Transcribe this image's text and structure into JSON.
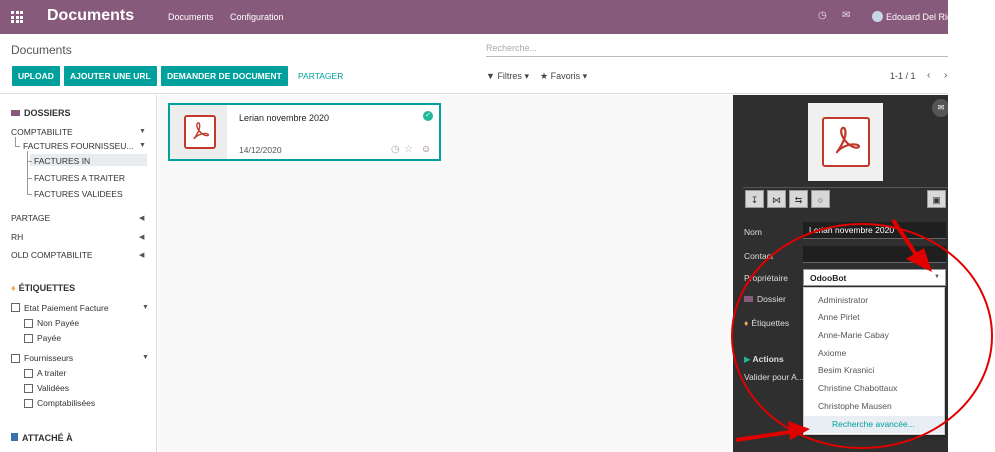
{
  "navbar": {
    "app_title": "Documents",
    "menu": [
      "Documents",
      "Configuration"
    ],
    "user": "Edouard Del Rio"
  },
  "control_panel": {
    "breadcrumb": "Documents",
    "search_placeholder": "Recherche...",
    "buttons": [
      "UPLOAD",
      "AJOUTER UNE URL",
      "DEMANDER DE DOCUMENT",
      "PARTAGER"
    ],
    "filters_label": "Filtres",
    "favorites_label": "Favoris",
    "pager": "1-1 / 1"
  },
  "sidebar": {
    "folders_title": "DOSSIERS",
    "folders": [
      "COMPTABILITE",
      "FACTURES FOURNISSEU...",
      "FACTURES IN",
      "FACTURES A TRAITER",
      "FACTURES VALIDEES",
      "PARTAGE",
      "RH",
      "OLD COMPTABILITE"
    ],
    "tags_title": "ÉTIQUETTES",
    "tags": [
      "Etat Paiement Facture",
      "Non Payée",
      "Payée",
      "Fournisseurs",
      "A traiter",
      "Validées",
      "Comptabilisées"
    ],
    "attached_title": "ATTACHÉ À"
  },
  "card": {
    "name": "Lerian novembre 2020",
    "date": "14/12/2020"
  },
  "panel": {
    "labels": [
      "Nom",
      "Contact",
      "Propriétaire",
      "Dossier",
      "Étiquettes",
      "Actions",
      "Valider pour A..."
    ],
    "name_value": "Lerian novembre 2020",
    "owner_value": "OdooBot"
  },
  "dropdown": {
    "options": [
      "Administrator",
      "Anne Pirlet",
      "Anne-Marie Cabay",
      "Axiome",
      "Besim Krasnici",
      "Christine Chabottaux",
      "Christophe Mausen"
    ],
    "advanced": "Recherche avancée..."
  },
  "colors": {
    "brand": "#875a7b",
    "accent": "#00a09d",
    "annotation": "#e00000"
  }
}
